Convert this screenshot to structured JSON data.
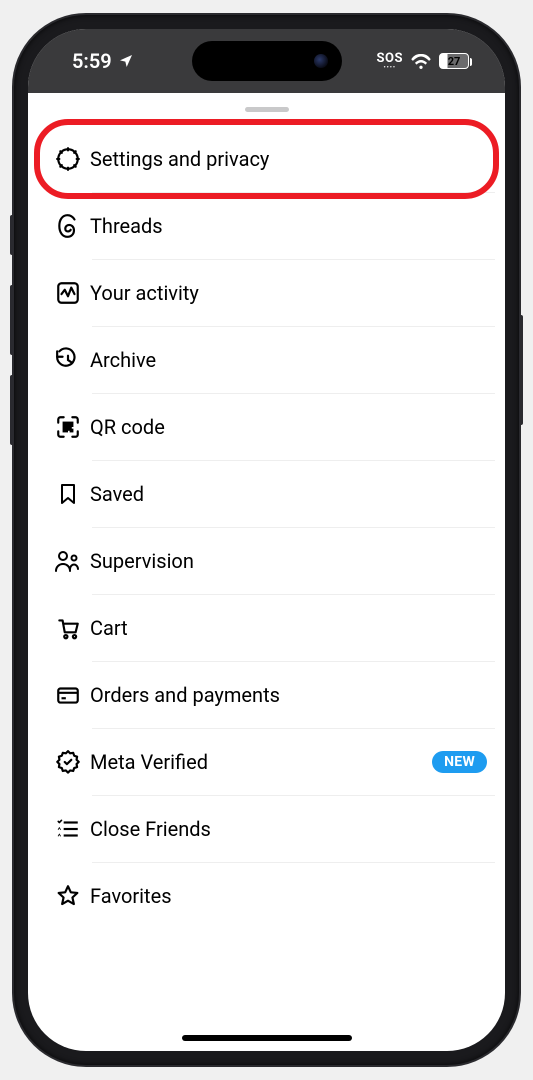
{
  "status_bar": {
    "time": "5:59",
    "sos": "SOS",
    "battery_percent": "27"
  },
  "menu": {
    "items": [
      {
        "label": "Settings and privacy",
        "highlighted": true
      },
      {
        "label": "Threads"
      },
      {
        "label": "Your activity"
      },
      {
        "label": "Archive"
      },
      {
        "label": "QR code"
      },
      {
        "label": "Saved"
      },
      {
        "label": "Supervision"
      },
      {
        "label": "Cart"
      },
      {
        "label": "Orders and payments"
      },
      {
        "label": "Meta Verified",
        "badge": "NEW"
      },
      {
        "label": "Close Friends"
      },
      {
        "label": "Favorites"
      }
    ]
  },
  "colors": {
    "highlight_ring": "#ec1c24",
    "badge_bg": "#1e9cf0"
  }
}
